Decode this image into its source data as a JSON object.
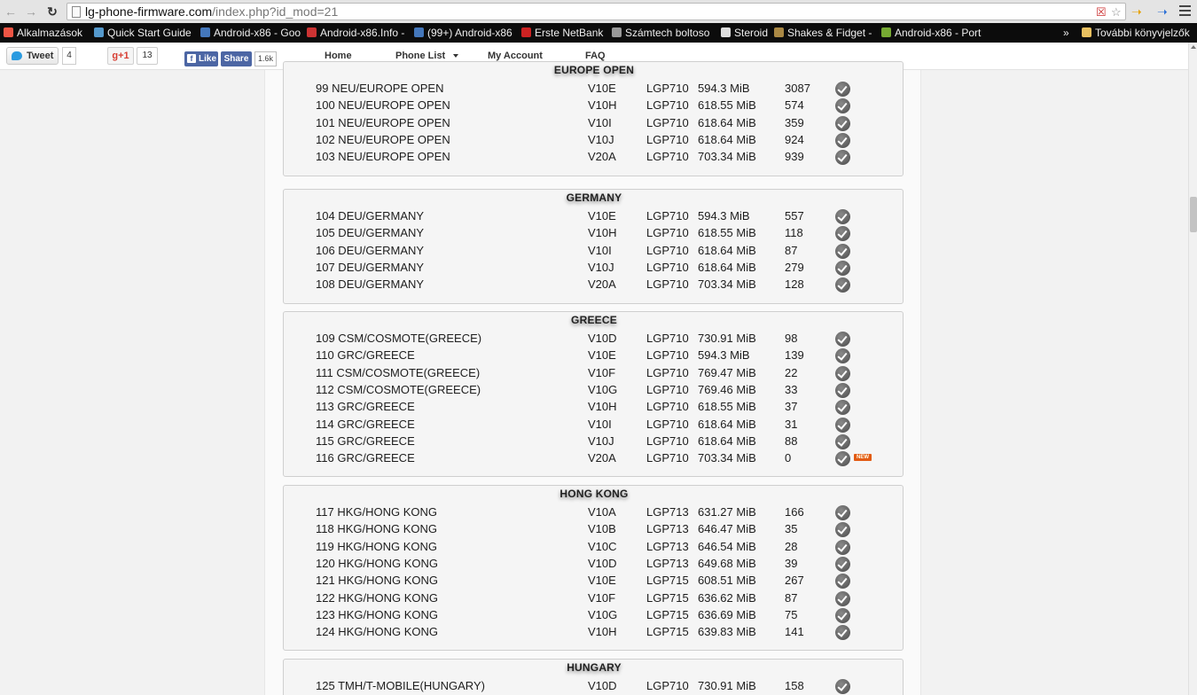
{
  "browser": {
    "url_host": "lg-phone-firmware.com",
    "url_path": "/index.php?id_mod=21",
    "bookmarks": [
      {
        "label": "Alkalmazások",
        "color": "#e54"
      },
      {
        "label": "Quick Start Guide",
        "color": "#59c"
      },
      {
        "label": "Android-x86 - Goo",
        "color": "#47b"
      },
      {
        "label": "Android-x86.Info -",
        "color": "#c33"
      },
      {
        "label": "(99+) Android-x86",
        "color": "#47b"
      },
      {
        "label": "Erste NetBank",
        "color": "#c22"
      },
      {
        "label": "Számtech boltoso",
        "color": "#999"
      },
      {
        "label": "Steroid",
        "color": "#ddd"
      },
      {
        "label": "Shakes & Fidget -",
        "color": "#a84"
      },
      {
        "label": "Android-x86 - Port",
        "color": "#7a3"
      }
    ],
    "more_bookmarks": "»",
    "other_bookmarks": "További könyvjelzők"
  },
  "social": {
    "tweet_label": "Tweet",
    "tweet_count": "4",
    "gplus_label": "g+1",
    "gplus_count": "13",
    "fb_like_label": "Like",
    "fb_share_label": "Share",
    "fb_count": "1.6k"
  },
  "nav": {
    "home": "Home",
    "phone_list": "Phone List",
    "my_account": "My Account",
    "faq": "FAQ"
  },
  "regions": [
    {
      "title": "EUROPE OPEN",
      "rows": [
        {
          "name": "99 NEU/EUROPE OPEN",
          "version": "V10E",
          "model": "LGP710",
          "size": "594.3 MiB",
          "downloads": "3087",
          "new": false
        },
        {
          "name": "100 NEU/EUROPE OPEN",
          "version": "V10H",
          "model": "LGP710",
          "size": "618.55 MiB",
          "downloads": "574",
          "new": false
        },
        {
          "name": "101 NEU/EUROPE OPEN",
          "version": "V10I",
          "model": "LGP710",
          "size": "618.64 MiB",
          "downloads": "359",
          "new": false
        },
        {
          "name": "102 NEU/EUROPE OPEN",
          "version": "V10J",
          "model": "LGP710",
          "size": "618.64 MiB",
          "downloads": "924",
          "new": false
        },
        {
          "name": "103 NEU/EUROPE OPEN",
          "version": "V20A",
          "model": "LGP710",
          "size": "703.34 MiB",
          "downloads": "939",
          "new": false
        }
      ]
    },
    {
      "title": "GERMANY",
      "rows": [
        {
          "name": "104 DEU/GERMANY",
          "version": "V10E",
          "model": "LGP710",
          "size": "594.3 MiB",
          "downloads": "557",
          "new": false
        },
        {
          "name": "105 DEU/GERMANY",
          "version": "V10H",
          "model": "LGP710",
          "size": "618.55 MiB",
          "downloads": "118",
          "new": false
        },
        {
          "name": "106 DEU/GERMANY",
          "version": "V10I",
          "model": "LGP710",
          "size": "618.64 MiB",
          "downloads": "87",
          "new": false
        },
        {
          "name": "107 DEU/GERMANY",
          "version": "V10J",
          "model": "LGP710",
          "size": "618.64 MiB",
          "downloads": "279",
          "new": false
        },
        {
          "name": "108 DEU/GERMANY",
          "version": "V20A",
          "model": "LGP710",
          "size": "703.34 MiB",
          "downloads": "128",
          "new": false
        }
      ]
    },
    {
      "title": "GREECE",
      "rows": [
        {
          "name": "109 CSM/COSMOTE(GREECE)",
          "version": "V10D",
          "model": "LGP710",
          "size": "730.91 MiB",
          "downloads": "98",
          "new": false
        },
        {
          "name": "110 GRC/GREECE",
          "version": "V10E",
          "model": "LGP710",
          "size": "594.3 MiB",
          "downloads": "139",
          "new": false
        },
        {
          "name": "111 CSM/COSMOTE(GREECE)",
          "version": "V10F",
          "model": "LGP710",
          "size": "769.47 MiB",
          "downloads": "22",
          "new": false
        },
        {
          "name": "112 CSM/COSMOTE(GREECE)",
          "version": "V10G",
          "model": "LGP710",
          "size": "769.46 MiB",
          "downloads": "33",
          "new": false
        },
        {
          "name": "113 GRC/GREECE",
          "version": "V10H",
          "model": "LGP710",
          "size": "618.55 MiB",
          "downloads": "37",
          "new": false
        },
        {
          "name": "114 GRC/GREECE",
          "version": "V10I",
          "model": "LGP710",
          "size": "618.64 MiB",
          "downloads": "31",
          "new": false
        },
        {
          "name": "115 GRC/GREECE",
          "version": "V10J",
          "model": "LGP710",
          "size": "618.64 MiB",
          "downloads": "88",
          "new": false
        },
        {
          "name": "116 GRC/GREECE",
          "version": "V20A",
          "model": "LGP710",
          "size": "703.34 MiB",
          "downloads": "0",
          "new": true
        }
      ]
    },
    {
      "title": "HONG KONG",
      "rows": [
        {
          "name": "117 HKG/HONG KONG",
          "version": "V10A",
          "model": "LGP713",
          "size": "631.27 MiB",
          "downloads": "166",
          "new": false
        },
        {
          "name": "118 HKG/HONG KONG",
          "version": "V10B",
          "model": "LGP713",
          "size": "646.47 MiB",
          "downloads": "35",
          "new": false
        },
        {
          "name": "119 HKG/HONG KONG",
          "version": "V10C",
          "model": "LGP713",
          "size": "646.54 MiB",
          "downloads": "28",
          "new": false
        },
        {
          "name": "120 HKG/HONG KONG",
          "version": "V10D",
          "model": "LGP713",
          "size": "649.68 MiB",
          "downloads": "39",
          "new": false
        },
        {
          "name": "121 HKG/HONG KONG",
          "version": "V10E",
          "model": "LGP715",
          "size": "608.51 MiB",
          "downloads": "267",
          "new": false
        },
        {
          "name": "122 HKG/HONG KONG",
          "version": "V10F",
          "model": "LGP715",
          "size": "636.62 MiB",
          "downloads": "87",
          "new": false
        },
        {
          "name": "123 HKG/HONG KONG",
          "version": "V10G",
          "model": "LGP715",
          "size": "636.69 MiB",
          "downloads": "75",
          "new": false
        },
        {
          "name": "124 HKG/HONG KONG",
          "version": "V10H",
          "model": "LGP715",
          "size": "639.83 MiB",
          "downloads": "141",
          "new": false
        }
      ]
    },
    {
      "title": "HUNGARY",
      "rows": [
        {
          "name": "125 TMH/T-MOBILE(HUNGARY)",
          "version": "V10D",
          "model": "LGP710",
          "size": "730.91 MiB",
          "downloads": "158",
          "new": false
        }
      ]
    }
  ],
  "new_badge_label": "NEW"
}
